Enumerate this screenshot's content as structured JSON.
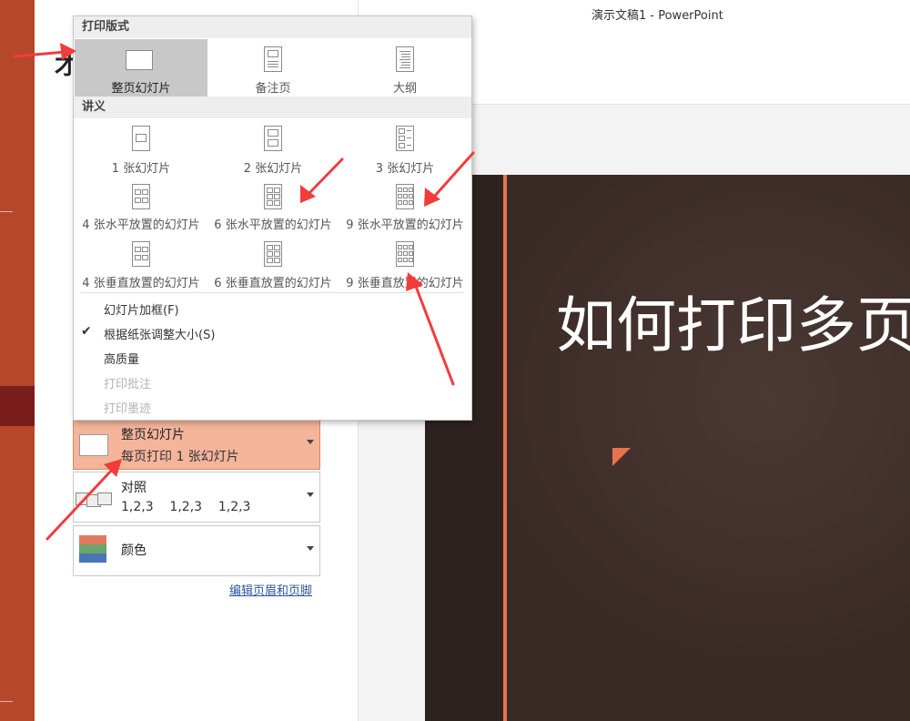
{
  "window": {
    "title": "演示文稿1  -  PowerPoint"
  },
  "backstage": {
    "page_glyph": "才"
  },
  "print_layout_menu": {
    "section_print_layout": "打印版式",
    "layouts": [
      {
        "label": "整页幻灯片",
        "selected": true,
        "icon": "full-page-slide-icon"
      },
      {
        "label": "备注页",
        "icon": "notes-page-icon"
      },
      {
        "label": "大纲",
        "icon": "outline-icon"
      }
    ],
    "section_handouts": "讲义",
    "handouts": [
      {
        "label": "1 张幻灯片"
      },
      {
        "label": "2 张幻灯片"
      },
      {
        "label": "3 张幻灯片"
      },
      {
        "label": "4 张水平放置的幻灯片"
      },
      {
        "label": "6 张水平放置的幻灯片"
      },
      {
        "label": "9 张水平放置的幻灯片"
      },
      {
        "label": "4 张垂直放置的幻灯片"
      },
      {
        "label": "6 张垂直放置的幻灯片"
      },
      {
        "label": "9 张垂直放置的幻灯片"
      }
    ],
    "options": [
      {
        "label": "幻灯片加框(F)",
        "checked": false,
        "enabled": true
      },
      {
        "label": "根据纸张调整大小(S)",
        "checked": true,
        "enabled": true
      },
      {
        "label": "高质量",
        "checked": false,
        "enabled": true
      },
      {
        "label": "打印批注",
        "checked": false,
        "enabled": false
      },
      {
        "label": "打印墨迹",
        "checked": false,
        "enabled": false
      }
    ]
  },
  "settings": {
    "layout": {
      "title": "整页幻灯片",
      "subtitle": "每页打印 1 张幻灯片"
    },
    "collation": {
      "title": "对照",
      "subtitle": "1,2,3    1,2,3    1,2,3"
    },
    "color": {
      "title": "颜色"
    },
    "edit_header_footer_link": "编辑页眉和页脚"
  },
  "preview": {
    "slide_title": "如何打印多页"
  },
  "colors": {
    "accent": "#e8734a",
    "rail": "#b7472a",
    "selected_setting": "#f4b59b",
    "slide_bg": "#3a2a26",
    "annotation_arrow": "#f23c3c"
  }
}
